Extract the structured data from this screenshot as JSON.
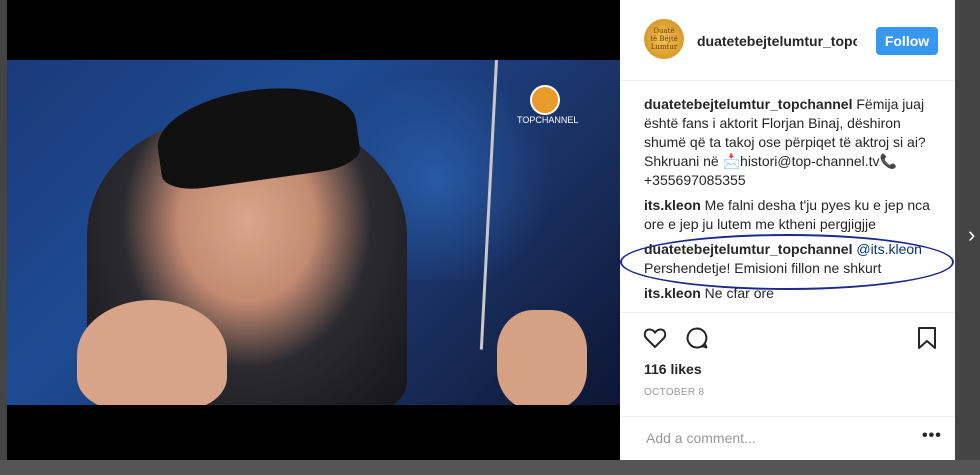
{
  "header": {
    "username": "duatetebejtelumtur_topc",
    "follow_label": "Follow",
    "avatar_text": "Duatë të Bëjtë Lumtur"
  },
  "photo": {
    "channel_logo_text": "TOPCHANNEL"
  },
  "comments": [
    {
      "user": "duatetebejtelumtur_topchannel",
      "text": " Fëmija juaj është fans i aktorit Florjan Binaj, dëshiron shumë që ta takoj ose përpiqet të aktroj si ai? Shkruani në 📩histori@top-channel.tv📞 +355697085355"
    },
    {
      "user": "its.kleon",
      "text": " Me falni desha t'ju pyes ku e jep nca ore e jep ju lutem me ktheni pergjigjje"
    },
    {
      "user": "duatetebejtelumtur_topchannel",
      "mention": " @its.kleon",
      "text": " Pershendetje! Emisioni fillon ne shkurt"
    },
    {
      "user": "its.kleon",
      "text": " Ne cfar ore"
    }
  ],
  "actions": {
    "likes": "116 likes",
    "date": "OCTOBER 8"
  },
  "add_comment": {
    "placeholder": "Add a comment...",
    "more": "•••"
  },
  "nav": {
    "next": "›"
  }
}
